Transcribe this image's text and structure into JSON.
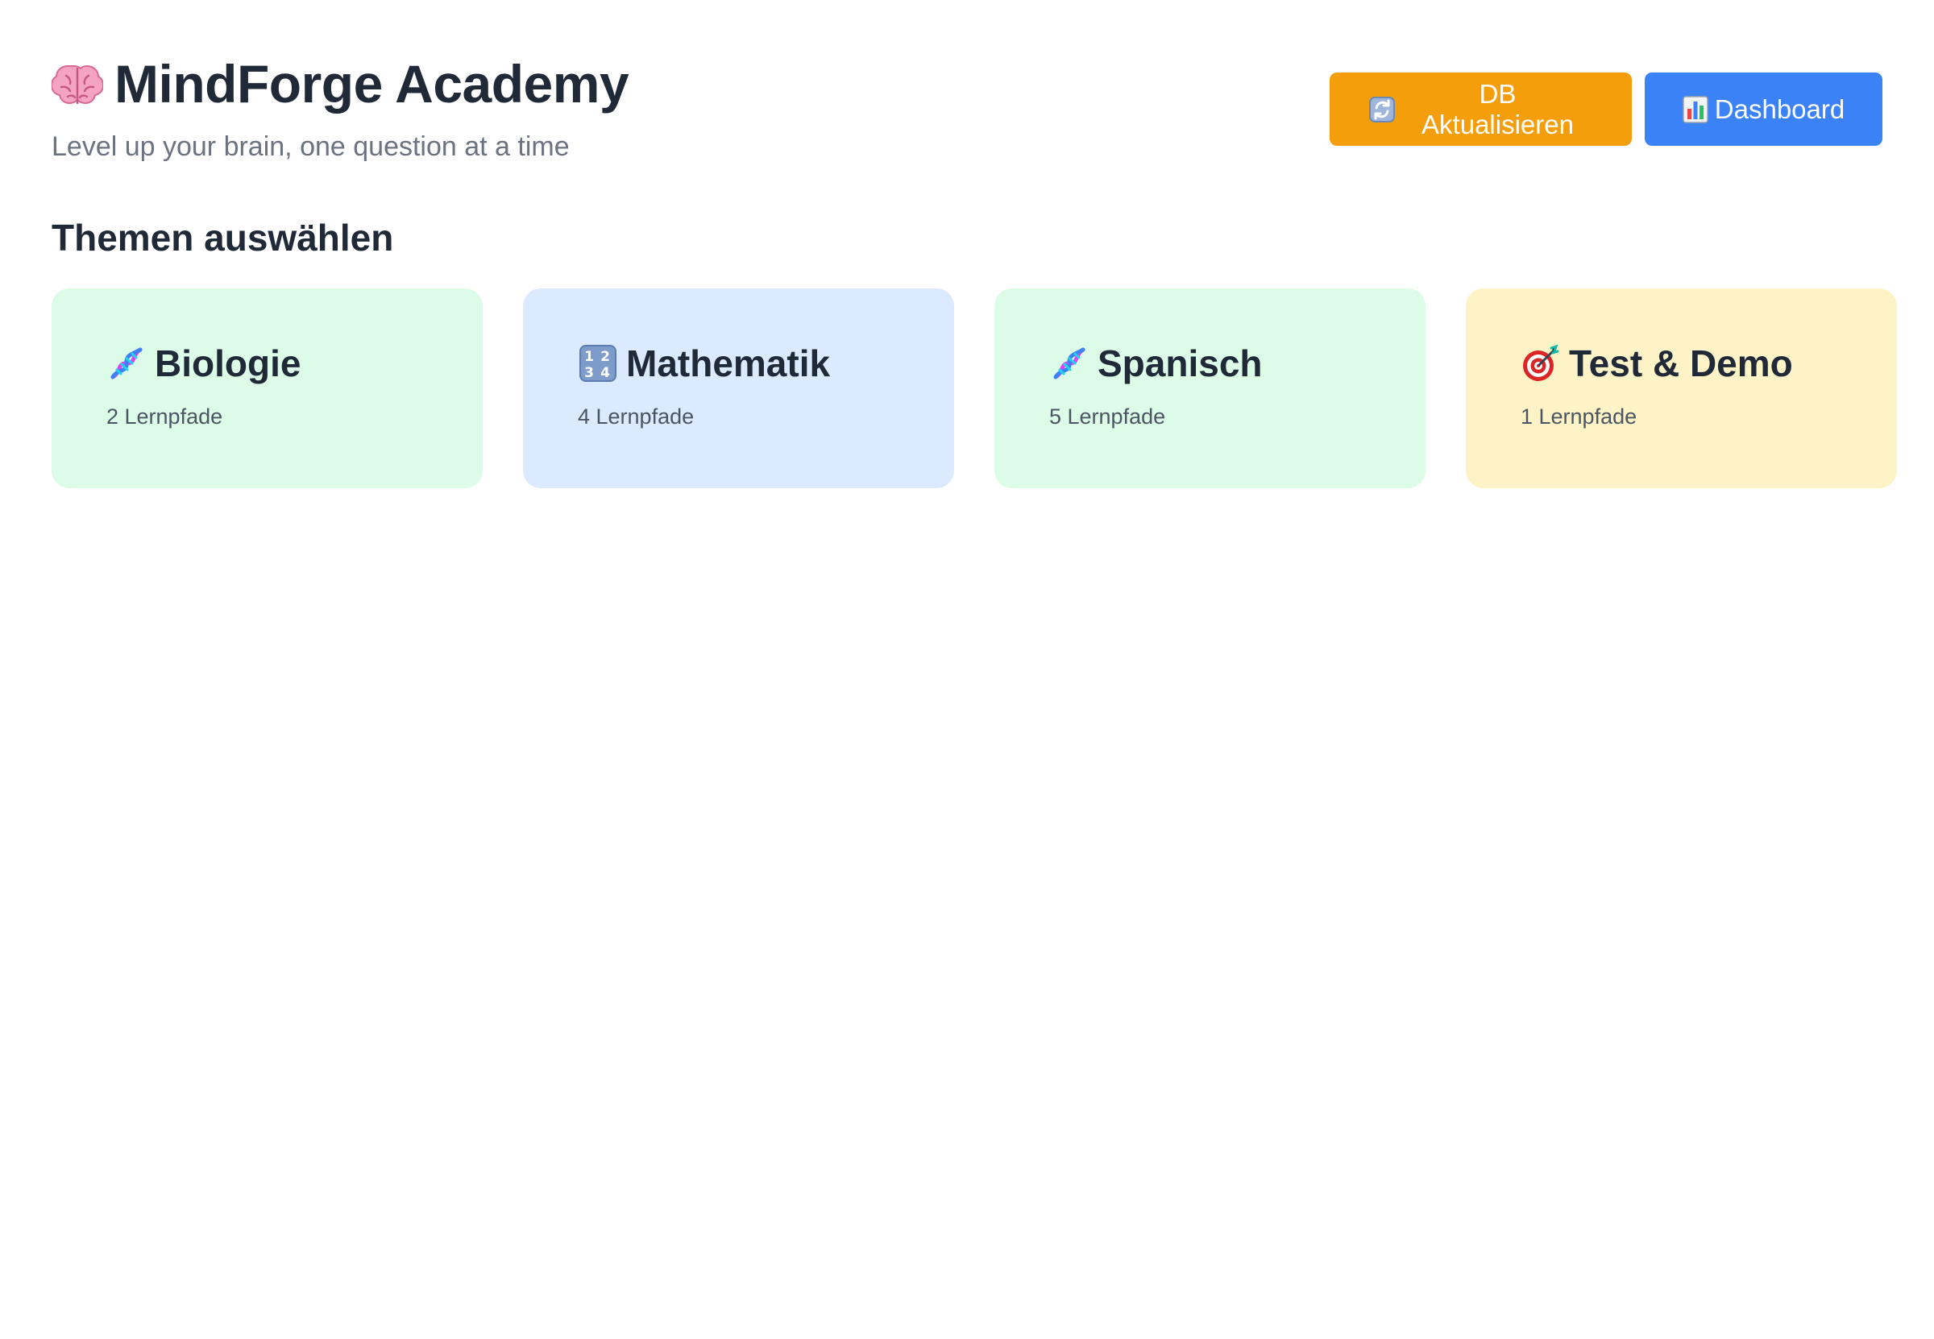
{
  "app": {
    "title": "MindForge Academy",
    "title_icon": "brain-icon",
    "subtitle": "Level up your brain, one question at a time"
  },
  "actions": {
    "update": {
      "label": "DB Aktualisieren",
      "icon": "refresh-icon",
      "color": "#f59e0b"
    },
    "dashboard": {
      "label": "Dashboard",
      "icon": "bar-chart-icon",
      "color": "#3b82f6"
    }
  },
  "section": {
    "title": "Themen auswählen"
  },
  "topics": [
    {
      "title": "Biologie",
      "count": "2 Lernpfade",
      "icon": "dna-icon",
      "bg": "#dcfce7"
    },
    {
      "title": "Mathematik",
      "count": "4 Lernpfade",
      "icon": "numbers-icon",
      "bg": "#dbeafe"
    },
    {
      "title": "Spanisch",
      "count": "5 Lernpfade",
      "icon": "dna-icon",
      "bg": "#dcfce7"
    },
    {
      "title": "Test & Demo",
      "count": "1 Lernpfade",
      "icon": "target-icon",
      "bg": "#fef3c7"
    }
  ]
}
